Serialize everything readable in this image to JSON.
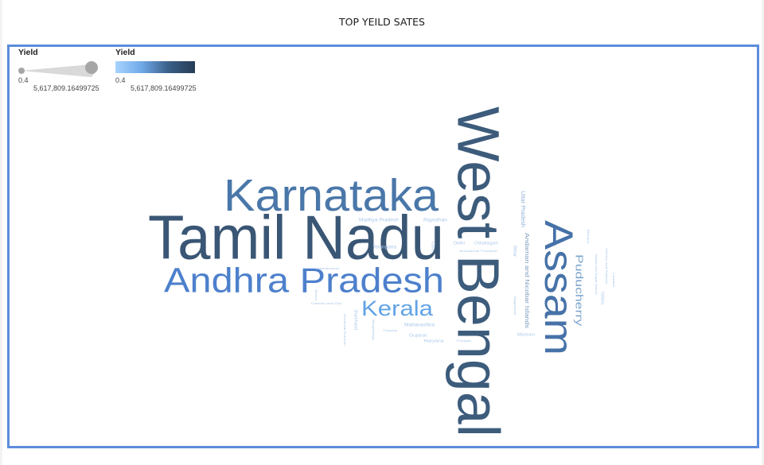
{
  "title": "TOP YEILD SATES",
  "legend": {
    "size": {
      "title": "Yield",
      "min": "0.4",
      "max": "5,617,809.16499725"
    },
    "color": {
      "title": "Yield",
      "min": "0.4",
      "max": "5,617,809.16499725"
    }
  },
  "chart_data": {
    "type": "wordcloud",
    "title": "TOP YEILD SATES",
    "measure": "Yield",
    "range": [
      0.4,
      5617809.16499725
    ],
    "words": [
      {
        "text": "West Bengal",
        "value": 5617809.16
      },
      {
        "text": "Tamil Nadu",
        "value": 5300000
      },
      {
        "text": "Karnataka",
        "value": 2900000
      },
      {
        "text": "Andhra Pradesh",
        "value": 2300000
      },
      {
        "text": "Assam",
        "value": 2300000
      },
      {
        "text": "Kerala",
        "value": 1300000
      },
      {
        "text": "Puducherry",
        "value": 500000
      },
      {
        "text": "Andaman and Nicobar Islands",
        "value": 300000
      },
      {
        "text": "Uttar Pradesh",
        "value": 240000
      },
      {
        "text": "Madhya Pradesh",
        "value": 110000
      },
      {
        "text": "Rajasthan",
        "value": 100000
      },
      {
        "text": "Telangana",
        "value": 90000
      },
      {
        "text": "Maharashtra",
        "value": 90000
      },
      {
        "text": "Gujarat",
        "value": 80000
      },
      {
        "text": "Haryana",
        "value": 80000
      },
      {
        "text": "Goa",
        "value": 70000
      },
      {
        "text": "Delhi",
        "value": 60000
      },
      {
        "text": "Chhattisgarh",
        "value": 50000
      },
      {
        "text": "Arunachal Pradesh",
        "value": 45000
      },
      {
        "text": "Bihar",
        "value": 45000
      },
      {
        "text": "Punjab",
        "value": 45000
      },
      {
        "text": "Mizoram",
        "value": 45000
      },
      {
        "text": "Nagaland",
        "value": 45000
      },
      {
        "text": "Odisha",
        "value": 40000
      },
      {
        "text": "Uttarakhand",
        "value": 40000
      },
      {
        "text": "Tripura",
        "value": 40000
      },
      {
        "text": "Jharkhand",
        "value": 40000
      },
      {
        "text": "Manipur",
        "value": 35000
      },
      {
        "text": "Sikkim",
        "value": 35000
      },
      {
        "text": "Ladakh",
        "value": 30000
      },
      {
        "text": "Jammu and Kashmir",
        "value": 30000
      },
      {
        "text": "Dadra and Nagar Haveli",
        "value": 30000
      },
      {
        "text": "Daman and Diu",
        "value": 30000
      },
      {
        "text": "Meghalaya",
        "value": 30000
      },
      {
        "text": "Himachal Pradesh",
        "value": 30000
      }
    ]
  }
}
